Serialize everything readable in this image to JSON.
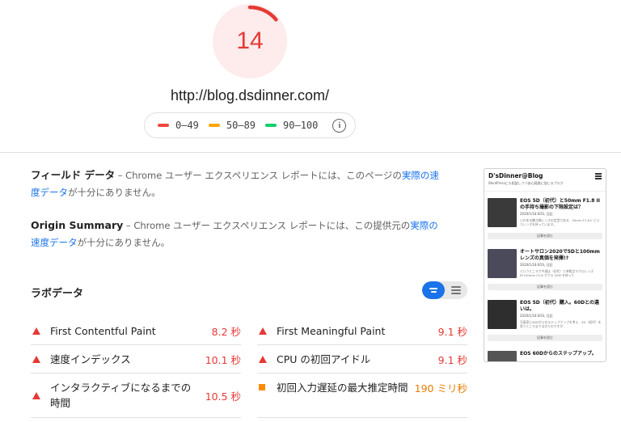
{
  "score": {
    "value": "14",
    "fraction": 0.14,
    "color": "#e53935"
  },
  "url": "http://blog.dsdinner.com/",
  "legend": [
    {
      "label": "0–49",
      "color": "#f0483e"
    },
    {
      "label": "50–89",
      "color": "#ffa400"
    },
    {
      "label": "90–100",
      "color": "#0cce6b"
    }
  ],
  "field_data": {
    "heading": "フィールド データ",
    "text_before": " – Chrome ユーザー エクスペリエンス レポートには、このページの",
    "link": "実際の速度データ",
    "text_after": "が十分にありません。"
  },
  "origin_summary": {
    "heading": "Origin Summary",
    "text_before": " – Chrome ユーザー エクスペリエンス レポートには、この提供元の",
    "link": "実際の速度データ",
    "text_after": "が十分にありません。"
  },
  "lab": {
    "title": "ラボデータ"
  },
  "metrics": [
    {
      "label": "First Contentful Paint",
      "value": "8.2 秒",
      "status": "fail"
    },
    {
      "label": "First Meaningful Paint",
      "value": "9.1 秒",
      "status": "fail"
    },
    {
      "label": "速度インデックス",
      "value": "10.1 秒",
      "status": "fail"
    },
    {
      "label": "CPU の初回アイドル",
      "value": "9.1 秒",
      "status": "fail"
    },
    {
      "label": "インタラクティブになるまでの時間",
      "value": "10.5 秒",
      "status": "fail"
    },
    {
      "label": "初回入力遅延の最大推定時間",
      "value": "190 ミリ秒",
      "status": "average"
    }
  ],
  "phone": {
    "site_title": "D'sDinner@Blog",
    "site_sub": "WordPressにも相談しつつ安心経路に悩じるブログ",
    "posts": [
      {
        "title": "EOS 5D（初代）と50mm F1.8 IIの手持ち撮影の下限設定は？",
        "meta": "2020/1/18  EOS, 日記",
        "excerpt": "いわゆる撒き餌レンズの定型である、50mm F1.8 II というレンズを持っています。",
        "button": "記事を読む"
      },
      {
        "title": "オートサロン2020で5Dと100mmレンズの真価を発揮!?",
        "meta": "2020/1/18  EOS, 日記",
        "excerpt": "というところで今週は（初代）と単焦点マクロレンズ EF100mm F2.8 マクロ USM を持って",
        "button": "記事を読む"
      },
      {
        "title": "EOS 5D（初代）購入。60Dとの違いは。",
        "meta": "2020/1/18  EOS, 日記",
        "excerpt": "写真家に60Dからのステップアップを考え、5D（初代）を思うところまではきたのですが、",
        "button": "記事を読む"
      },
      {
        "title": "EOS 60Dからのステップアップ。",
        "meta": "",
        "excerpt": "",
        "button": ""
      }
    ]
  }
}
